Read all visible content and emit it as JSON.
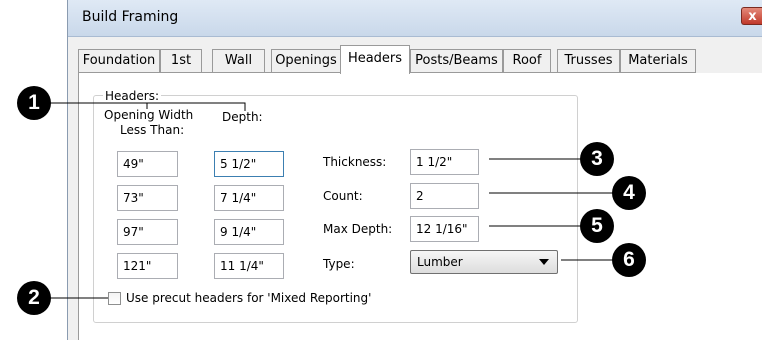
{
  "window": {
    "title": "Build Framing",
    "close_label": "x"
  },
  "tabs": [
    {
      "label": "Foundation",
      "active": false
    },
    {
      "label": "1st",
      "active": false
    },
    {
      "label": "Wall",
      "active": false
    },
    {
      "label": "Openings",
      "active": false
    },
    {
      "label": "Headers",
      "active": true
    },
    {
      "label": "Posts/Beams",
      "active": false
    },
    {
      "label": "Roof",
      "active": false
    },
    {
      "label": "Trusses",
      "active": false
    },
    {
      "label": "Materials",
      "active": false
    }
  ],
  "headers": {
    "group_label": "Headers:",
    "col_opening_line1": "Opening Width",
    "col_opening_line2": "Less Than:",
    "col_depth": "Depth:",
    "rows": [
      {
        "opening": "49\"",
        "depth": "5 1/2\""
      },
      {
        "opening": "73\"",
        "depth": "7 1/4\""
      },
      {
        "opening": "97\"",
        "depth": "9 1/4\""
      },
      {
        "opening": "121\"",
        "depth": "11 1/4\""
      }
    ],
    "thickness_label": "Thickness:",
    "thickness_value": "1 1/2\"",
    "count_label": "Count:",
    "count_value": "2",
    "max_depth_label": "Max Depth:",
    "max_depth_value": "12 1/16\"",
    "type_label": "Type:",
    "type_value": "Lumber",
    "precut_label": "Use precut headers for 'Mixed Reporting'",
    "precut_checked": false
  },
  "callouts": [
    "1",
    "2",
    "3",
    "4",
    "5",
    "6"
  ]
}
